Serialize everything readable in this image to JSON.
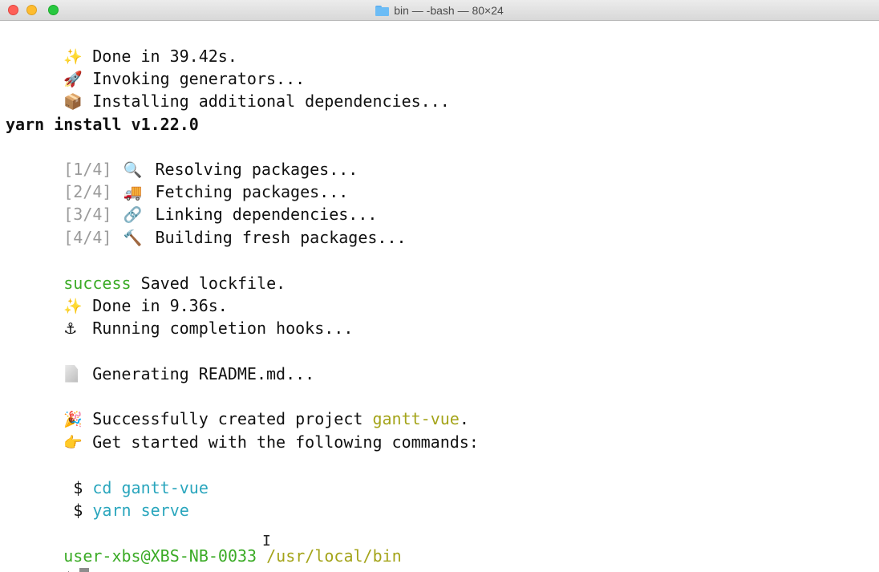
{
  "window": {
    "title": "bin — -bash — 80×24",
    "folder_icon": "folder-icon"
  },
  "lines": {
    "l1": {
      "icon": "✨",
      "text": "Done in 39.42s."
    },
    "l2": {
      "icon": "🚀",
      "text": "Invoking generators..."
    },
    "l3": {
      "icon": "📦",
      "text": "Installing additional dependencies..."
    },
    "yarn_header": "yarn install v1.22.0",
    "steps": [
      {
        "step": "[1/4]",
        "icon": "🔍",
        "text": "Resolving packages..."
      },
      {
        "step": "[2/4]",
        "icon": "🚚",
        "text": "Fetching packages..."
      },
      {
        "step": "[3/4]",
        "icon": "🔗",
        "text": "Linking dependencies..."
      },
      {
        "step": "[4/4]",
        "icon": "🔨",
        "text": "Building fresh packages..."
      }
    ],
    "success_word": "success",
    "success_text": " Saved lockfile.",
    "l_done2": {
      "icon": "✨",
      "text": "Done in 9.36s."
    },
    "l_hooks": {
      "icon": "⚓",
      "text": "Running completion hooks..."
    },
    "l_readme": {
      "text": "Generating README.md..."
    },
    "l_created": {
      "icon": "🎉",
      "text_before": "Successfully created project ",
      "project": "gantt-vue",
      "text_after": "."
    },
    "l_started": {
      "icon": "👉",
      "text": "Get started with the following commands:"
    },
    "cmd1": {
      "dollar": " $ ",
      "cmd": "cd gantt-vue"
    },
    "cmd2": {
      "dollar": " $ ",
      "cmd": "yarn serve"
    },
    "prompt_user": "user-xbs@XBS-NB-0033",
    "prompt_path": " /usr/local/bin",
    "prompt_dollar": "$"
  },
  "colors": {
    "success": "#3bab26",
    "project": "#a4a41a",
    "command": "#2aa6bd"
  }
}
